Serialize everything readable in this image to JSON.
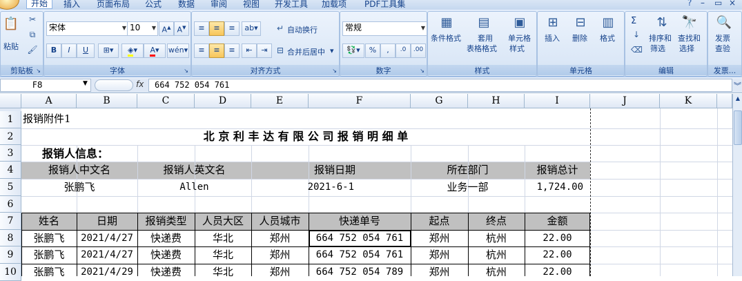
{
  "tabs": [
    "开始",
    "插入",
    "页面布局",
    "公式",
    "数据",
    "审阅",
    "视图",
    "开发工具",
    "加载项",
    "PDF工具集"
  ],
  "clipboard": {
    "paste": "粘贴",
    "label": "剪贴板"
  },
  "font": {
    "name": "宋体",
    "size": "10",
    "label": "字体",
    "bold": "B",
    "italic": "I",
    "underline": "U"
  },
  "align": {
    "wrap": "自动换行",
    "merge": "合并后居中",
    "label": "对齐方式"
  },
  "number": {
    "format": "常规",
    "percent": "%",
    "comma": ",",
    "label": "数字"
  },
  "styles": {
    "cond": "条件格式",
    "table1": "套用",
    "table2": "表格格式",
    "cell1": "单元格",
    "cell2": "样式",
    "label": "样式"
  },
  "cells": {
    "insert": "插入",
    "delete": "删除",
    "format": "格式",
    "label": "单元格"
  },
  "editing": {
    "sigma": "Σ",
    "sort1": "排序和",
    "sort2": "筛选",
    "find1": "查找和",
    "find2": "选择",
    "label": "编辑"
  },
  "invoice": {
    "l1": "发票",
    "l2": "查验",
    "label": "发票..."
  },
  "formula": {
    "namebox": "F8",
    "fx": "fx",
    "value": "664 752 054 761"
  },
  "columns": [
    "A",
    "B",
    "C",
    "D",
    "E",
    "F",
    "G",
    "H",
    "I",
    "J",
    "K"
  ],
  "rows": [
    "1",
    "2",
    "3",
    "4",
    "5",
    "6",
    "7",
    "8",
    "9",
    "10"
  ],
  "sheet": {
    "a1": "报销附件1",
    "title": "北 京 利 丰 达 有 限 公 司 报 销 明 细 单",
    "info": "报销人信息：",
    "h_cn": "报销人中文名",
    "h_en": "报销人英文名",
    "h_date": "报销日期",
    "h_dept": "所在部门",
    "h_total": "报销总计",
    "v_cn": "张鹏飞",
    "v_en": "Allen",
    "v_date": "2021-6-1",
    "v_dept": "业务一部",
    "v_total": "1,724.00",
    "table_headers": [
      "姓名",
      "日期",
      "报销类型",
      "人员大区",
      "人员城市",
      "快递单号",
      "起点",
      "终点",
      "金额"
    ],
    "table_rows": [
      [
        "张鹏飞",
        "2021/4/27",
        "快递费",
        "华北",
        "郑州",
        "664 752 054 761",
        "郑州",
        "杭州",
        "22.00"
      ],
      [
        "张鹏飞",
        "2021/4/27",
        "快递费",
        "华北",
        "郑州",
        "664 752 054 761",
        "郑州",
        "杭州",
        "22.00"
      ],
      [
        "张鹏飞",
        "2021/4/29",
        "快递费",
        "华北",
        "郑州",
        "664 752 054 789",
        "郑州",
        "杭州",
        "22.00"
      ]
    ]
  }
}
